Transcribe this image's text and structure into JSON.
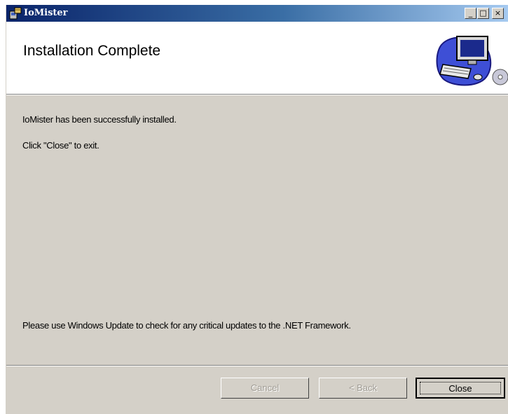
{
  "window": {
    "title": "IoMister",
    "controls": {
      "minimize": "_",
      "maximize": "□",
      "close": "×"
    }
  },
  "header": {
    "title": "Installation Complete",
    "art_icon": "computer-cd-icon"
  },
  "body": {
    "line1": "IoMister has been successfully installed.",
    "line2": "Click \"Close\" to exit.",
    "line3": "Please use Windows Update to check for any critical updates to the .NET Framework."
  },
  "buttons": {
    "cancel": "Cancel",
    "back": "< Back",
    "close": "Close"
  },
  "colors": {
    "titlebar_start": "#0a246a",
    "titlebar_end": "#a6caf0",
    "face": "#d4d0c8"
  }
}
